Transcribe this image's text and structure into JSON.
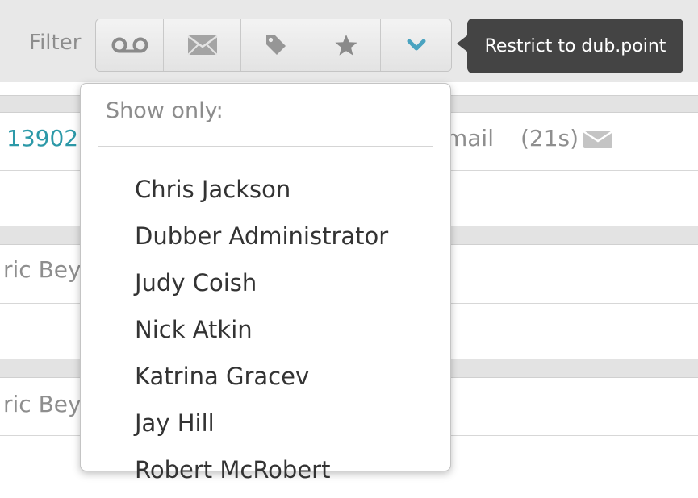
{
  "filter": {
    "label": "Filter",
    "buttons": [
      {
        "icon": "voicemail-icon"
      },
      {
        "icon": "envelope-icon"
      },
      {
        "icon": "tag-icon"
      },
      {
        "icon": "star-icon"
      },
      {
        "icon": "chevron-down-icon"
      }
    ],
    "accent_color": "#4aa3c0"
  },
  "tooltip": {
    "text": "Restrict to dub.point"
  },
  "background_rows": {
    "row1": {
      "number": "13902",
      "type": "mail",
      "duration": "(21s)",
      "icon": "envelope-icon"
    },
    "row2": {
      "name": "ric Bey"
    },
    "row3": {
      "name": "ric Bey"
    }
  },
  "dropdown": {
    "title": "Show only:",
    "items": [
      "Chris Jackson",
      "Dubber Administrator",
      "Judy Coish",
      "Nick Atkin",
      "Katrina Gracev",
      "Jay Hill",
      "Robert McRobert"
    ]
  },
  "colors": {
    "link": "#2c99a8",
    "tooltip_bg": "#444444"
  }
}
